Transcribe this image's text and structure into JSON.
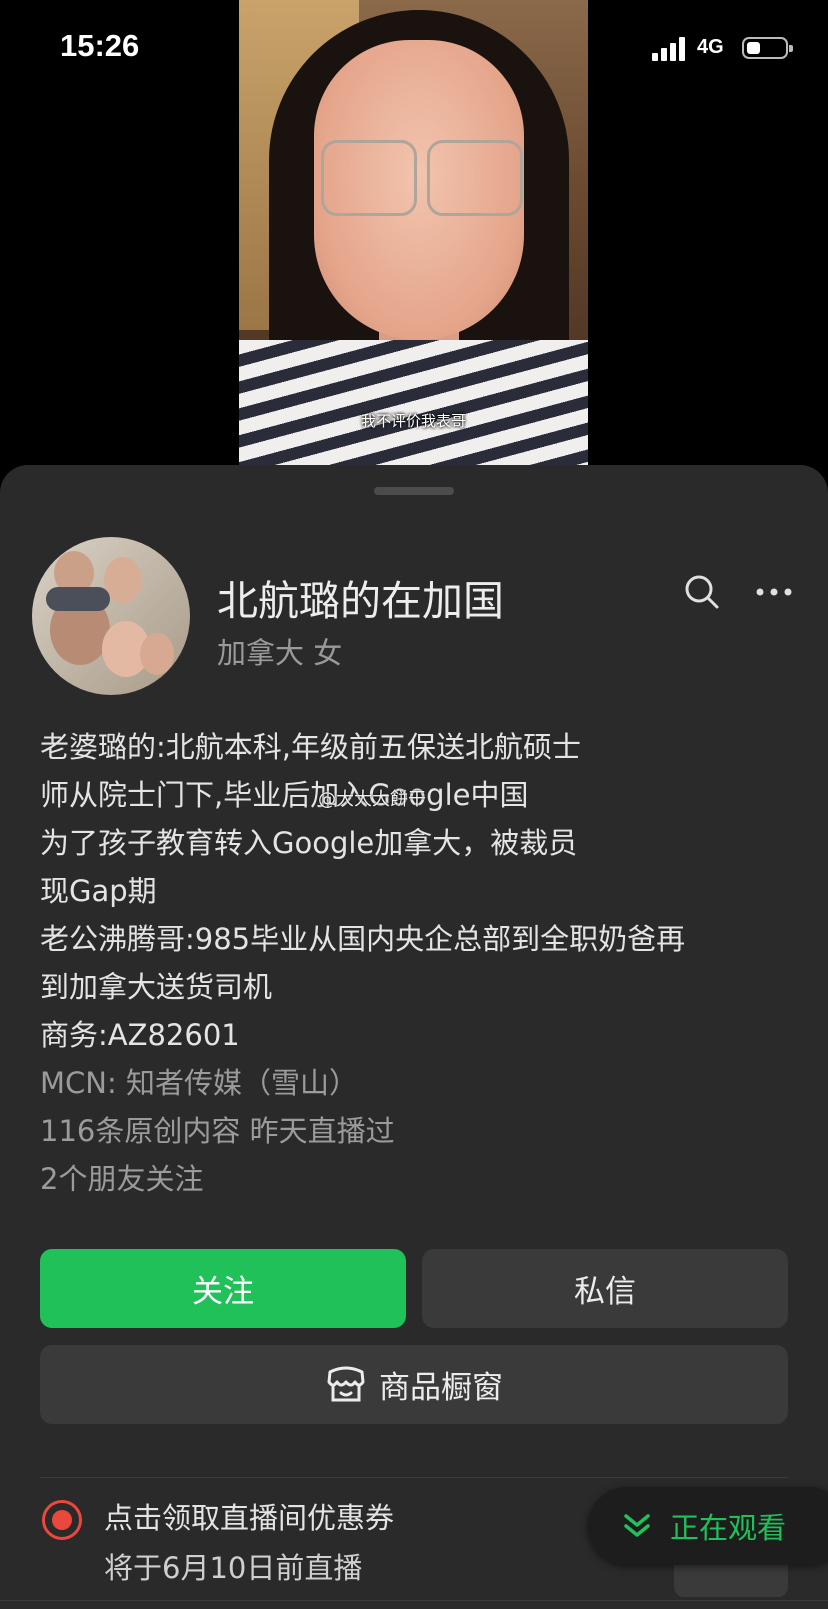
{
  "status_bar": {
    "time": "15:26",
    "network": "4G"
  },
  "video": {
    "subtitle": "我不评价我表哥"
  },
  "profile": {
    "name": "北航璐的在加国",
    "location_gender": "加拿大 女",
    "bio_lines": [
      "老婆璐的:北航本科,年级前五保送北航硕士",
      "师从院士门下,毕业后加入Google中国",
      "为了孩子教育转入Google加拿大，被裁员",
      "现Gap期",
      "老公沸腾哥:985毕业从国内央企总部到全职奶爸再",
      "到加拿大送货司机",
      "商务:AZ82601"
    ],
    "mcn": "MCN: 知者传媒（雪山）",
    "stats": "116条原创内容  昨天直播过",
    "friends": "2个朋友关注",
    "watermark": "@大大大餅干"
  },
  "actions": {
    "follow": "关注",
    "message": "私信",
    "shop": "商品橱窗"
  },
  "live": {
    "title": "点击领取直播间优惠券",
    "subtitle": "将于6月10日前直播"
  },
  "watching": {
    "label": "正在观看"
  },
  "colors": {
    "accent": "#21c15a",
    "live": "#e9493c",
    "sheet_bg": "#2a2a2a"
  },
  "icons": [
    "search-icon",
    "more-icon",
    "shop-window-icon",
    "live-icon",
    "chevron-down-icon"
  ]
}
